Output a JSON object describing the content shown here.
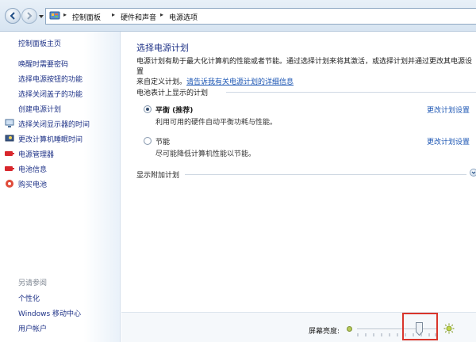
{
  "address_bar": {
    "breadcrumbs": [
      "控制面板",
      "硬件和声音",
      "电源选项"
    ]
  },
  "sidebar": {
    "home": "控制面板主页",
    "items": [
      {
        "label": "唤醒时需要密码",
        "icon": null
      },
      {
        "label": "选择电源按钮的功能",
        "icon": null
      },
      {
        "label": "选择关闭盖子的功能",
        "icon": null
      },
      {
        "label": "创建电源计划",
        "icon": null
      },
      {
        "label": "选择关闭显示器的时间",
        "icon": "monitor-icon"
      },
      {
        "label": "更改计算机睡眠时间",
        "icon": "moon-icon"
      },
      {
        "label": "电源管理器",
        "icon": "battery-red-icon"
      },
      {
        "label": "电池信息",
        "icon": "battery-red-icon"
      },
      {
        "label": "购买电池",
        "icon": "shop-icon"
      }
    ],
    "see_also": {
      "title": "另请参阅",
      "items": [
        "个性化",
        "Windows 移动中心",
        "用户帐户"
      ]
    }
  },
  "main": {
    "title": "选择电源计划",
    "description_line1": "电源计划有助于最大化计算机的性能或者节能。通过选择计划来将其激活，或选择计划并通过更改其电源设置",
    "description_line2_prefix": "来自定义计划。",
    "description_link": "请告诉我有关电源计划的详细信息",
    "group_header": "电池表计上显示的计划",
    "plans": [
      {
        "name": "平衡 (推荐)",
        "description": "利用可用的硬件自动平衡功耗与性能。",
        "link": "更改计划设置",
        "selected": true
      },
      {
        "name": "节能",
        "description": "尽可能降低计算机性能以节能。",
        "link": "更改计划设置",
        "selected": false
      }
    ],
    "additional_plans": "显示附加计划"
  },
  "bottom": {
    "brightness_label": "屏幕亮度:",
    "brightness_level_percent": 75
  },
  "colors": {
    "link": "#1e3287",
    "highlight": "#d9352b"
  }
}
